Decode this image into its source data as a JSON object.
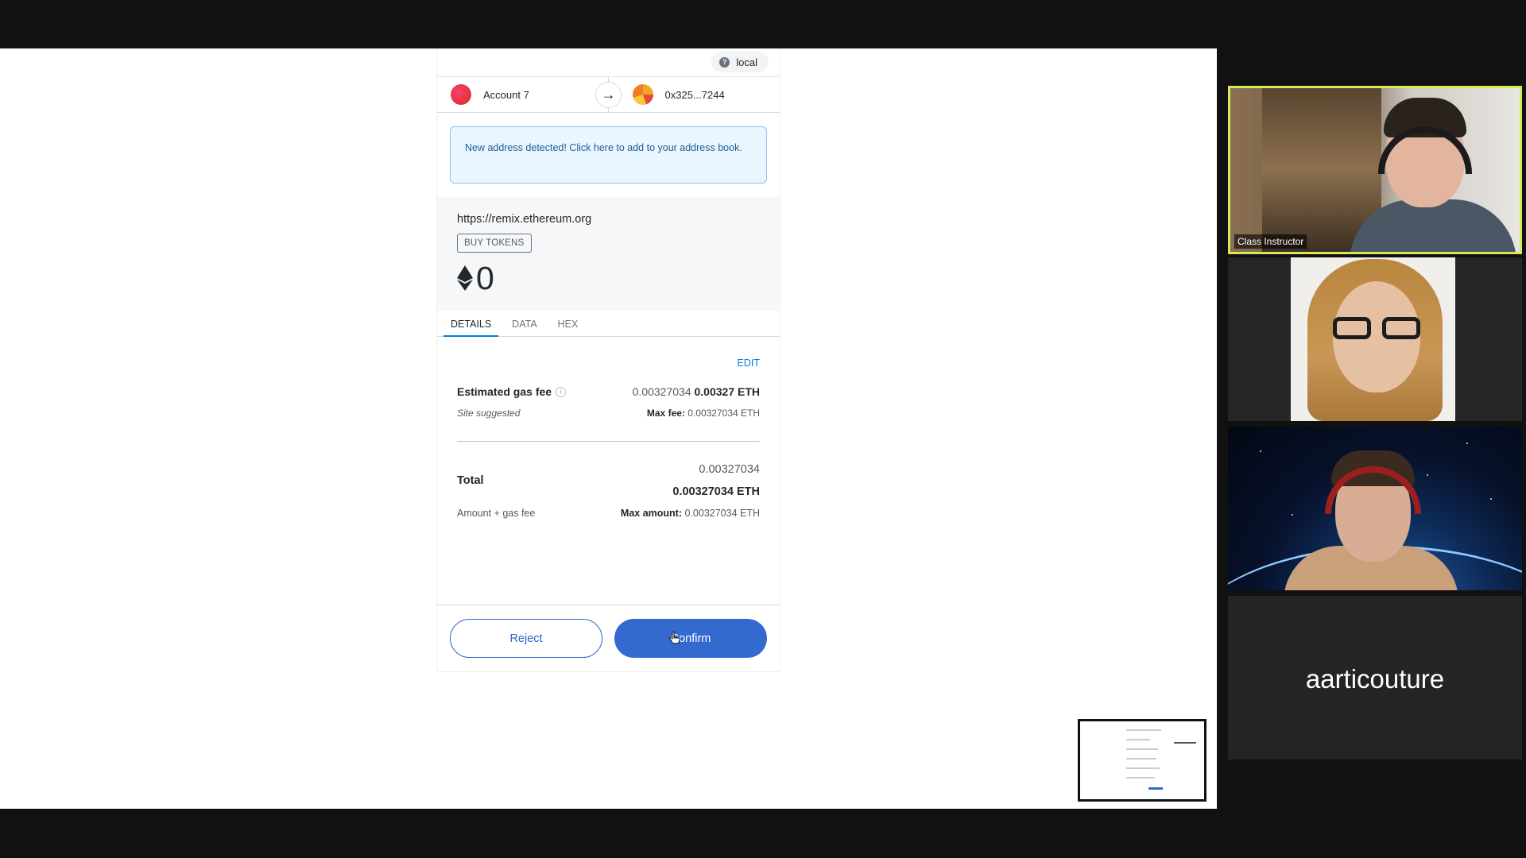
{
  "metamask": {
    "network": "local",
    "from_account": "Account 7",
    "to_address": "0x325...7244",
    "notice": "New address detected! Click here to add to your address book.",
    "origin": "https://remix.ethereum.org",
    "buy_tokens": "BUY TOKENS",
    "amount": "0",
    "tabs": [
      "DETAILS",
      "DATA",
      "HEX"
    ],
    "active_tab": "DETAILS",
    "edit": "EDIT",
    "gas": {
      "label": "Estimated gas fee",
      "value_small": "0.00327034",
      "value_bold": "0.00327 ETH",
      "site_suggested": "Site suggested",
      "max_fee_label": "Max fee:",
      "max_fee_value": "0.00327034 ETH"
    },
    "total": {
      "label": "Total",
      "value_small": "0.00327034",
      "value_bold": "0.00327034 ETH",
      "sublabel": "Amount + gas fee",
      "max_amount_label": "Max amount:",
      "max_amount_value": "0.00327034 ETH"
    },
    "reject_label": "Reject",
    "confirm_label": "Confirm"
  },
  "participants": [
    {
      "name": "Class Instructor",
      "active_speaker": true
    },
    {
      "name": ""
    },
    {
      "name": ""
    },
    {
      "name": "aarticouture"
    }
  ],
  "colors": {
    "accent_blue": "#3469d0",
    "link_blue": "#037dd6",
    "active_speaker_border": "#d9e85a",
    "notice_bg": "#eaf6ff"
  }
}
